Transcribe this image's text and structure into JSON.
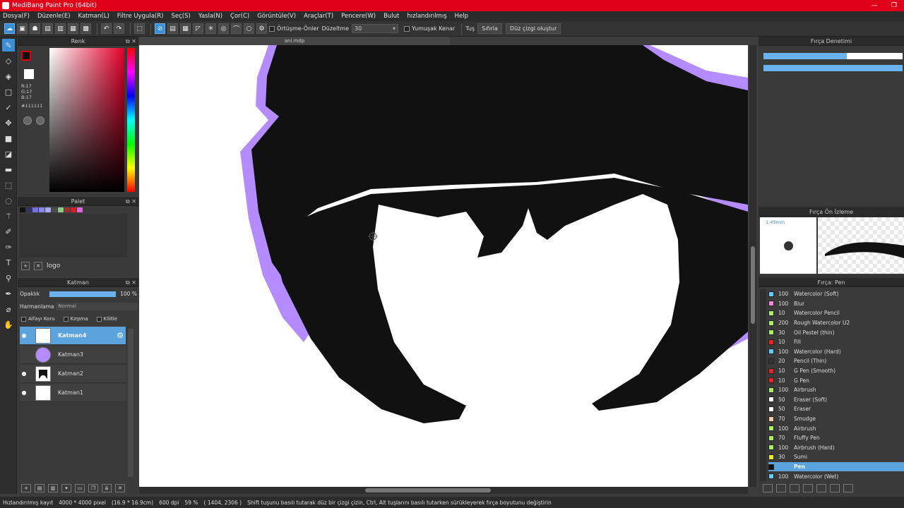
{
  "window": {
    "title": "MediBang Paint Pro (64bit)",
    "minimize": "—",
    "restore": "❐"
  },
  "menu": [
    "Dosya(F)",
    "Düzenle(E)",
    "Katman(L)",
    "Filtre Uygula(R)",
    "Seç(S)",
    "Yasla(N)",
    "Çor(C)",
    "Görüntüle(V)",
    "Araçlar(T)",
    "Pencere(W)",
    "Bulut",
    "hızlandırılmış",
    "Help"
  ],
  "toolbar": {
    "antialias_label": "Örtüşme-Önler",
    "correction_label": "Düzeltme",
    "correction_value": "30",
    "soft_edge_label": "Yumuşak Kenar",
    "tug_label": "Tuş",
    "reset_label": "Sıfırla",
    "line_label": "Düz çizgi oluştur"
  },
  "color_panel": {
    "title": "Renk",
    "r": "R:17",
    "g": "G:17",
    "b": "B:17",
    "hex": "#111111",
    "fg": "#111111",
    "bg": "#ffffff"
  },
  "palette_panel": {
    "title": "Palet",
    "palette_name": "logo",
    "swatches": [
      "#111111",
      "#333366",
      "#7a6ee6",
      "#8888ee",
      "#aaaaee",
      "#4c4c4c",
      "#88cc88",
      "#993333",
      "#cc2222",
      "#dd66dd"
    ]
  },
  "layer_panel": {
    "title": "Katman",
    "opacity_label": "Opaklık",
    "opacity_value": "100 %",
    "opacity": 1.0,
    "blend_label": "Harmanlama",
    "blend_value": "Normal",
    "alpha_lock": "Alfayı Koru",
    "clipping": "Kırpma",
    "lock": "Kilitle",
    "layers": [
      {
        "name": "Katman4",
        "selected": true,
        "visible": true
      },
      {
        "name": "Katman3",
        "selected": false,
        "visible": false
      },
      {
        "name": "Katman2",
        "selected": false,
        "visible": true
      },
      {
        "name": "Katman1",
        "selected": false,
        "visible": true
      }
    ]
  },
  "document_tab": "ani.mdp",
  "brush_control": {
    "title": "Fırça Denetimi",
    "size_fraction": 0.6,
    "opacity_fraction": 1.0
  },
  "brush_preview": {
    "title": "Fırça Ön İzleme",
    "size": "1.45mm"
  },
  "brush_list": {
    "title": "Fırça: Pen",
    "items": [
      {
        "size": "100",
        "name": "Watercolor (Soft)",
        "color": "#66ccff"
      },
      {
        "size": "100",
        "name": "Blur",
        "color": "#ff88dd"
      },
      {
        "size": "10",
        "name": "Watercolor Pencil",
        "color": "#aaee66"
      },
      {
        "size": "200",
        "name": "Rough Watercolor U2",
        "color": "#aaee66"
      },
      {
        "size": "30",
        "name": "Oil Pastel (thin)",
        "color": "#aaee66"
      },
      {
        "size": "10",
        "name": "Fill",
        "color": "#ee2222"
      },
      {
        "size": "100",
        "name": "Watercolor (Hard)",
        "color": "#66ccff"
      },
      {
        "size": "20",
        "name": "Pencil (Thin)",
        "color": "#333333"
      },
      {
        "size": "10",
        "name": "G Pen (Smooth)",
        "color": "#ee2222"
      },
      {
        "size": "10",
        "name": "G Pen",
        "color": "#ee2222"
      },
      {
        "size": "100",
        "name": "Airbrush",
        "color": "#aaee66"
      },
      {
        "size": "50",
        "name": "Eraser (Soft)",
        "color": "#ffffff"
      },
      {
        "size": "50",
        "name": "Eraser",
        "color": "#ffffff"
      },
      {
        "size": "70",
        "name": "Smudge",
        "color": "#ffccaa"
      },
      {
        "size": "100",
        "name": "Airbrush",
        "color": "#aaee66"
      },
      {
        "size": "70",
        "name": "Fluffy Pen",
        "color": "#aaee66"
      },
      {
        "size": "100",
        "name": "Airbrush (Hard)",
        "color": "#aaee66"
      },
      {
        "size": "30",
        "name": "Sumi",
        "color": "#eeee22"
      },
      {
        "size": "",
        "name": "Pen",
        "color": "#111111",
        "selected": true
      },
      {
        "size": "100",
        "name": "Watercolor (Wet)",
        "color": "#66ccff"
      }
    ]
  },
  "status": {
    "mode": "Hızlandırılmış kayıt",
    "canvas_size": "4000 * 4000 pixel",
    "physical_size": "(16.9 * 16.9cm)",
    "dpi": "600 dpi",
    "zoom": "59 %",
    "cursor": "( 1404, 2306 )",
    "hint": "Shift tuşunu basılı tutarak düz bir çizgi çizin, Ctrl, Alt tuşlarını basılı tutarken sürükleyerek fırça boyutunu değiştirin"
  },
  "colors": {
    "accent": "#3a8fd6",
    "title_bar": "#e0001a",
    "hair": "#111111",
    "outline": "#b48cff"
  }
}
